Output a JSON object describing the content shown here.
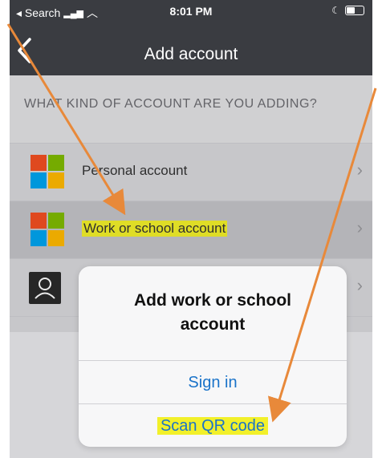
{
  "status_bar": {
    "back_app": "◂ Search",
    "time": "8:01 PM"
  },
  "nav": {
    "title": "Add account"
  },
  "section": {
    "header": "WHAT KIND OF ACCOUNT ARE YOU ADDING?"
  },
  "rows": [
    {
      "label": "Personal account"
    },
    {
      "label": "Work or school account"
    }
  ],
  "alert": {
    "title": "Add work or school account",
    "sign_in": "Sign in",
    "scan_qr": "Scan QR code"
  },
  "colors": {
    "highlight": "#f2f02a",
    "arrow": "#e8893a",
    "link": "#1a73c9"
  }
}
